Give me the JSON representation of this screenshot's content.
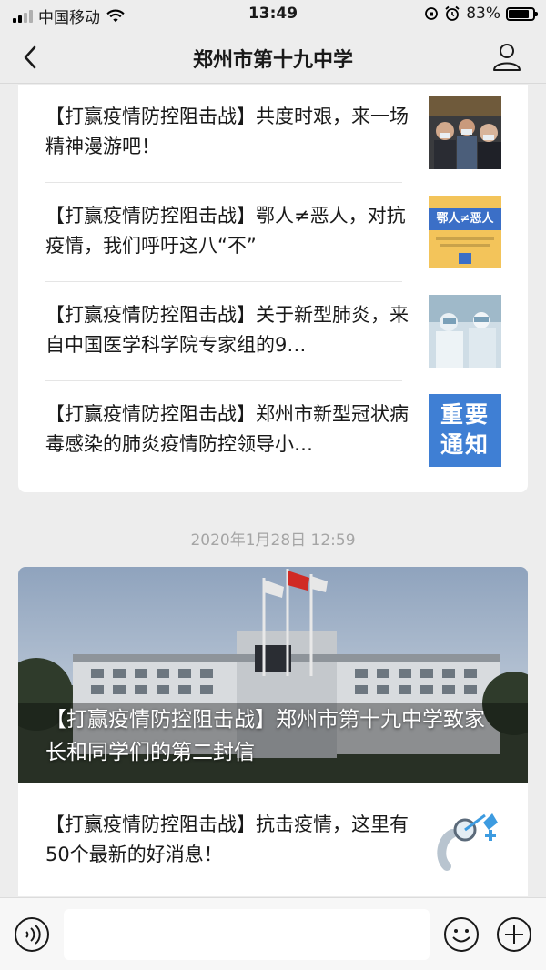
{
  "status_bar": {
    "carrier": "中国移动",
    "time": "13:49",
    "battery_text": "83%",
    "battery_level": 0.83
  },
  "nav": {
    "title": "郑州市第十九中学"
  },
  "articles_top": [
    {
      "text": "【打赢疫情防控阻击战】共度时艰，来一场精神漫游吧！"
    },
    {
      "text": "【打赢疫情防控阻击战】鄂人≠恶人，对抗疫情，我们呼吁这八“不”",
      "thumb_text": "鄂人≠恶人"
    },
    {
      "text": "【打赢疫情防控阻击战】关于新型肺炎，来自中国医学科学院专家组的9…"
    },
    {
      "text": "【打赢疫情防控阻击战】郑州市新型冠状病毒感染的肺炎疫情防控领导小…",
      "thumb_text": "重要通知"
    }
  ],
  "timestamp": "2020年1月28日 12:59",
  "cover_article": {
    "headline": "【打赢疫情防控阻击战】郑州市第十九中学致家长和同学们的第二封信"
  },
  "articles_bottom": [
    {
      "text": "【打赢疫情防控阻击战】抗击疫情，这里有50个最新的好消息！"
    }
  ],
  "input_bar": {
    "placeholder": ""
  },
  "colors": {
    "background": "#ededed",
    "card": "#ffffff",
    "notice_blue": "#3f7fd4",
    "poster_yellow": "#f3c45a"
  }
}
